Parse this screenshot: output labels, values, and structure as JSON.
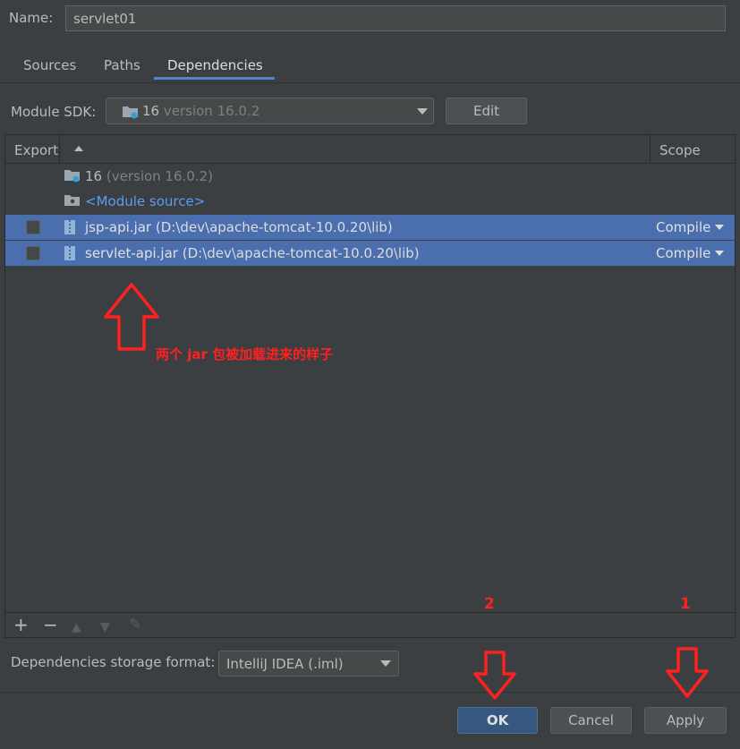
{
  "name_field": {
    "label": "Name:",
    "value": "servlet01"
  },
  "tabs": [
    {
      "label": "Sources",
      "active": false
    },
    {
      "label": "Paths",
      "active": false
    },
    {
      "label": "Dependencies",
      "active": true
    }
  ],
  "module_sdk": {
    "label": "Module SDK:",
    "name": "16",
    "version": "version 16.0.2",
    "edit_label": "Edit"
  },
  "table": {
    "headers": {
      "export": "Export",
      "scope": "Scope"
    },
    "rows": [
      {
        "name": "16",
        "detail": "(version 16.0.2)",
        "icon": "folder-icon"
      },
      {
        "name": "<Module source>",
        "icon": "folder-icon"
      },
      {
        "name": "jsp-api.jar",
        "detail": "(D:\\dev\\apache-tomcat-10.0.20\\lib)",
        "scope": "Compile",
        "icon": "jar-icon",
        "selected": true
      },
      {
        "name": "servlet-api.jar",
        "detail": "(D:\\dev\\apache-tomcat-10.0.20\\lib)",
        "scope": "Compile",
        "icon": "jar-icon",
        "selected": true
      }
    ]
  },
  "toolbar": {
    "add": "+",
    "remove": "−",
    "up": "▲",
    "down": "▼",
    "edit": "✎"
  },
  "storage": {
    "label": "Dependencies storage format:",
    "value": "IntelliJ IDEA (.iml)"
  },
  "buttons": {
    "ok": "OK",
    "cancel": "Cancel",
    "apply": "Apply"
  },
  "annotations": {
    "caption": "两个 jar 包被加载进来的样子",
    "step_ok": "2",
    "step_apply": "1",
    "color": "#ff2020"
  },
  "colors": {
    "background": "#3c3f41",
    "selection": "#4b6eaf",
    "ok_button": "#365880",
    "link": "#589df6"
  }
}
